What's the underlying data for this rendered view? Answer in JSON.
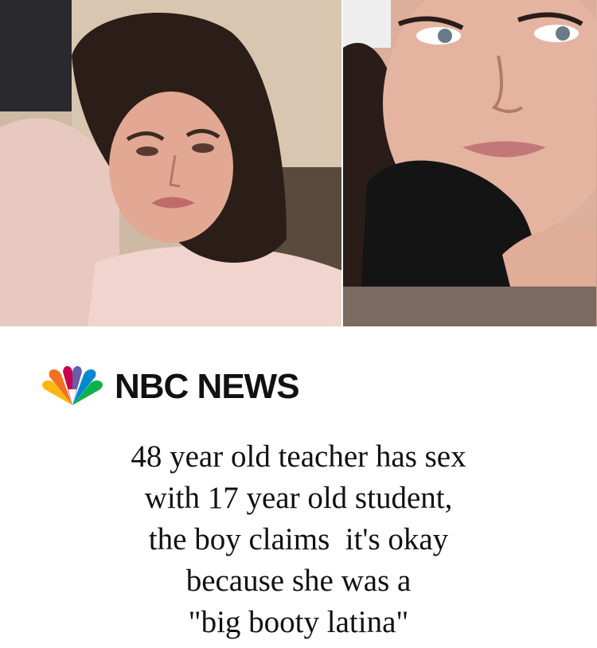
{
  "brand": {
    "logo_icon": "nbc-peacock-icon",
    "name": "NBC NEWS",
    "peacock_colors": [
      "#fcb711",
      "#f37021",
      "#cc004c",
      "#6460aa",
      "#0089d0",
      "#0db14b"
    ]
  },
  "headline": {
    "lines": [
      "48 year old teacher has sex",
      "with 17 year old student,",
      "the boy claims  it's okay",
      "because she was a",
      "\"big booty latina\""
    ]
  }
}
